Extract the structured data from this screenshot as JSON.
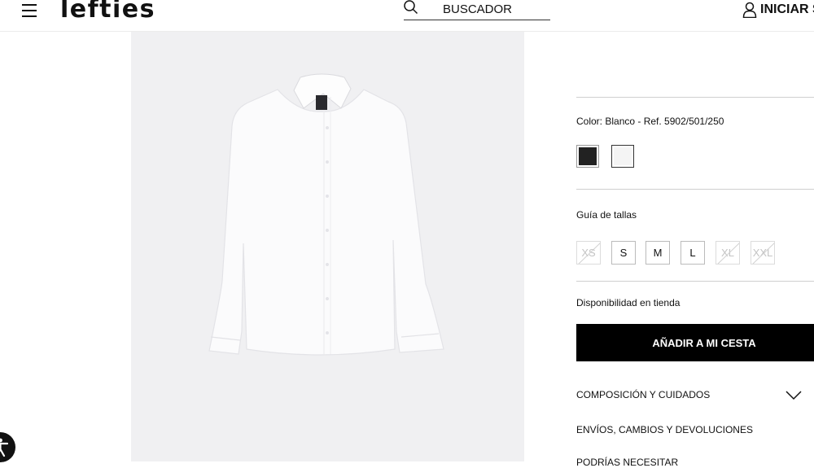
{
  "header": {
    "logo": "lefties",
    "menu_icon": "hamburger-menu-icon",
    "search": {
      "icon": "search-icon",
      "placeholder": "BUSCADOR"
    },
    "login": {
      "icon": "user-icon",
      "label": "INICIAR S"
    }
  },
  "product": {
    "image_alt": "Camisa blanca de manga larga",
    "color_label": "Color: Blanco - Ref. 5902/501/250",
    "swatches": [
      {
        "name": "Negro",
        "hex": "#222222",
        "selected": false
      },
      {
        "name": "Blanco",
        "hex": "#f4f4f4",
        "selected": true
      }
    ],
    "size_guide_label": "Guía de tallas",
    "sizes": [
      {
        "label": "XS",
        "available": false
      },
      {
        "label": "S",
        "available": true
      },
      {
        "label": "M",
        "available": true
      },
      {
        "label": "L",
        "available": true
      },
      {
        "label": "XL",
        "available": false
      },
      {
        "label": "XXL",
        "available": false
      }
    ],
    "store_availability_label": "Disponibilidad en tienda",
    "add_to_cart_label": "AÑADIR A MI CESTA",
    "accordion": [
      {
        "label": "COMPOSICIÓN Y CUIDADOS",
        "icon": "chevron-down-icon"
      },
      {
        "label": "ENVÍOS, CAMBIOS Y DEVOLUCIONES"
      },
      {
        "label": "PODRÍAS NECESITAR"
      }
    ]
  },
  "accessibility_icon": "accessibility-icon",
  "colors": {
    "primary_button": "#000000",
    "text": "#111111",
    "divider": "#cfcfcf"
  }
}
